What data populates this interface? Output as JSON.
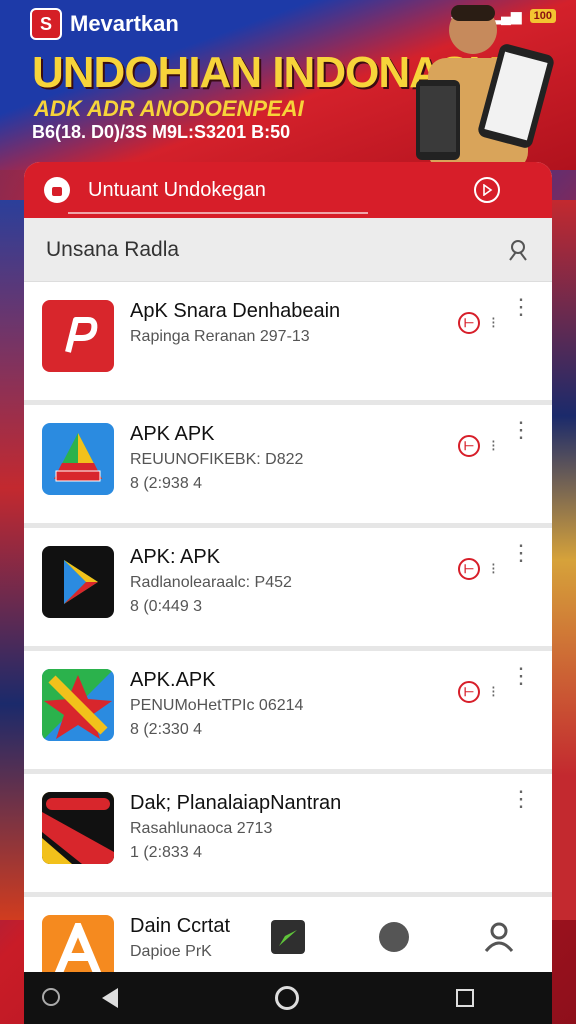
{
  "status": {
    "battery": "100"
  },
  "banner": {
    "brand": "Mevartkan",
    "headline": "UNDOHIAN INDONASIA",
    "subhead": "ADK ADR ANODOENPEAI",
    "dateline": "B6(18. D0)/3S M9L:S3201 B:50"
  },
  "panel": {
    "header_title": "Untuant Undokegan",
    "search_label": "Unsana Radla"
  },
  "apps": [
    {
      "title": "ApK Snara Denhabeain",
      "sub": "Rapinga Reranan 297-13",
      "meta": ""
    },
    {
      "title": "APK APK",
      "sub": "REUUNOFIKEBK: D822",
      "meta": "8 (2:938  4"
    },
    {
      "title": "APK: APK",
      "sub": "Radlanolearaalc: P452",
      "meta": "8 (0:449  3"
    },
    {
      "title": "APK.APK",
      "sub": "PENUMoHetTPIc 06214",
      "meta": "8 (2:330  4"
    },
    {
      "title": "Dak; PlanalaiapNantran",
      "sub": "Rasahlunaoca 2713",
      "meta": "1 (2:833  4"
    },
    {
      "title": "Dain Ccrtat",
      "sub": "Dapioe PrK",
      "meta": ""
    }
  ],
  "icons": {
    "brand": "s-logo-icon",
    "lock": "lock-icon",
    "play": "play-circle-icon",
    "user": "user-search-icon"
  },
  "colors": {
    "primary_red": "#d71e29",
    "headline_yellow": "#f7d43a"
  }
}
